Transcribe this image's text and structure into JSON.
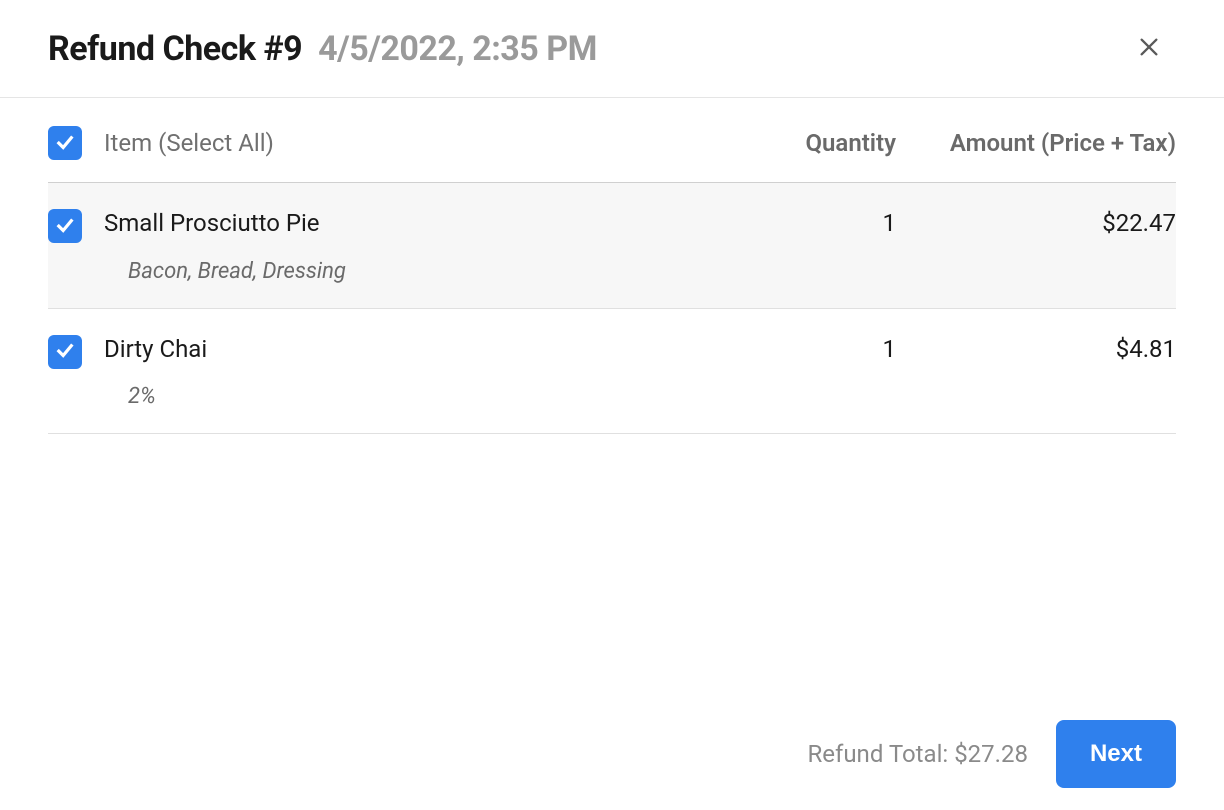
{
  "header": {
    "title": "Refund Check #9",
    "timestamp": "4/5/2022, 2:35 PM"
  },
  "table": {
    "select_all_checked": true,
    "columns": {
      "item": "Item (Select All)",
      "quantity": "Quantity",
      "amount": "Amount (Price + Tax)"
    },
    "rows": [
      {
        "checked": true,
        "selected": true,
        "name": "Small Prosciutto Pie",
        "modifiers": "Bacon, Bread, Dressing",
        "quantity": "1",
        "amount": "$22.47"
      },
      {
        "checked": true,
        "selected": false,
        "name": "Dirty Chai",
        "modifiers": "2%",
        "quantity": "1",
        "amount": "$4.81"
      }
    ]
  },
  "footer": {
    "refund_total_label": "Refund Total: ",
    "refund_total_value": "$27.28",
    "next_label": "Next"
  }
}
